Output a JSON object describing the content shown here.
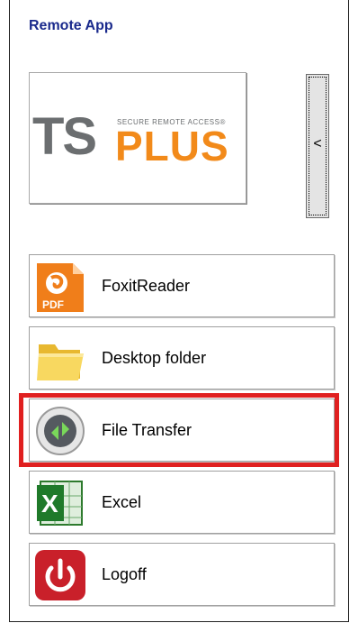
{
  "panel": {
    "title": "Remote App"
  },
  "logo": {
    "ts": "TS",
    "plus": "PLUS",
    "tagline": "SECURE REMOTE ACCESS®"
  },
  "collapse_button": {
    "label": "<"
  },
  "apps": [
    {
      "label": "FoxitReader",
      "icon": "foxit-pdf-icon",
      "pdf_text": "PDF"
    },
    {
      "label": "Desktop folder",
      "icon": "folder-icon"
    },
    {
      "label": "File Transfer",
      "icon": "file-transfer-icon"
    },
    {
      "label": "Excel",
      "icon": "excel-icon",
      "letter": "X"
    },
    {
      "label": "Logoff",
      "icon": "power-icon"
    }
  ],
  "colors": {
    "title": "#1a2a8c",
    "highlight": "#e02020",
    "logo_gray": "#6b6e70",
    "logo_orange": "#f28a1a"
  }
}
